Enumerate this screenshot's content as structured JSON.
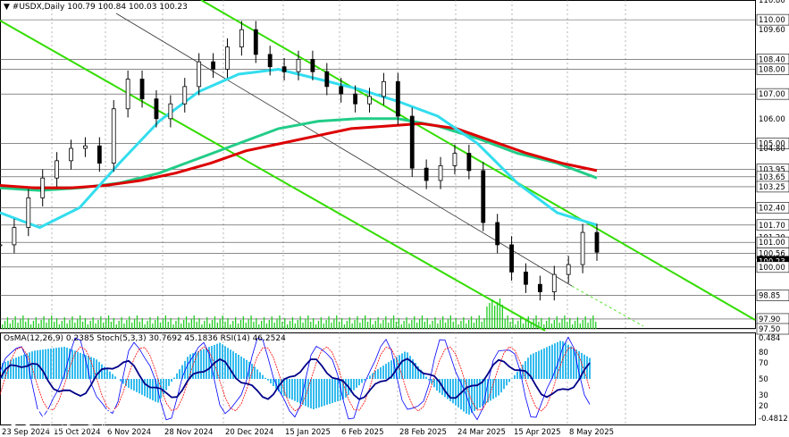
{
  "header": {
    "symbol": "#USDX,Daily",
    "ohlc": "100.79 100.84 100.03 100.23"
  },
  "price_axis": {
    "labels": [
      "110.80",
      "110.00",
      "109.60",
      "108.40",
      "108.00",
      "107.00",
      "106.00",
      "105.00",
      "104.80",
      "103.95",
      "103.65",
      "103.25",
      "102.40",
      "101.70",
      "101.20",
      "101.00",
      "100.56",
      "100.23",
      "100.00",
      "98.85",
      "97.90",
      "97.50"
    ],
    "highlighted": [
      "110.00",
      "108.40",
      "108.00",
      "107.00",
      "105.00",
      "103.95",
      "103.65",
      "103.25",
      "102.40",
      "101.70",
      "101.00",
      "100.56",
      "100.00",
      "98.85",
      "97.90",
      "97.50"
    ],
    "current": "100.23"
  },
  "time_axis": {
    "labels": [
      "23 Sep 2024",
      "15 Oct 2024",
      "6 Nov 2024",
      "28 Nov 2024",
      "20 Dec 2024",
      "15 Jan 2025",
      "6 Feb 2025",
      "28 Feb 2025",
      "24 Mar 2025",
      "15 Apr 2025",
      "8 May 2025"
    ]
  },
  "indicator": {
    "title": "OsMA(12,26,9) 0.2385  Stoch(5,3,3) 30.7692 45.1836  RSI(14) 46.2524",
    "axis_labels": [
      "0.484",
      "80",
      "70",
      "50",
      "30",
      "20",
      "-0.4812"
    ]
  },
  "logo": {
    "name": "instaforex",
    "tagline": "Instant Forex Trading"
  },
  "colors": {
    "price_series": "#000000",
    "ema200": "#dd0000",
    "ema144": "#22cc88",
    "ema50": "#33ddee",
    "channel": "#33dd00",
    "volume": "#22cc22",
    "osma": "#33bbee",
    "stoch_main": "#0000ff",
    "stoch_signal": "#ff0000",
    "rsi": "#000088"
  },
  "chart_data": {
    "type": "line",
    "x_labels": [
      "23 Sep 2024",
      "15 Oct 2024",
      "6 Nov 2024",
      "28 Nov 2024",
      "20 Dec 2024",
      "15 Jan 2025",
      "6 Feb 2025",
      "28 Feb 2025",
      "24 Mar 2025",
      "15 Apr 2025",
      "8 May 2025"
    ],
    "ylim": [
      97.5,
      110.8
    ],
    "series": [
      {
        "name": "price",
        "values": [
          100.9,
          101.6,
          102.8,
          103.6,
          104.3,
          104.8,
          104.9,
          104.2,
          106.4,
          107.6,
          106.8,
          106.0,
          106.6,
          107.3,
          108.3,
          108.0,
          108.9,
          109.6,
          108.6,
          108.1,
          107.9,
          108.4,
          107.9,
          107.3,
          107.0,
          106.6,
          106.9,
          107.5,
          106.1,
          104.0,
          103.5,
          104.1,
          104.6,
          103.9,
          101.8,
          100.9,
          99.8,
          99.3,
          99.0,
          99.7,
          100.1,
          101.4,
          100.6
        ]
      },
      {
        "values": [
          103.3,
          103.2,
          103.2,
          103.3,
          103.5,
          103.8,
          104.2,
          104.7,
          105.0,
          105.3,
          105.6,
          105.7,
          105.8,
          105.6,
          105.1,
          104.6,
          104.2,
          103.9
        ]
      },
      {
        "values": [
          103.2,
          103.1,
          103.2,
          103.4,
          103.8,
          104.4,
          105.0,
          105.6,
          105.9,
          106.0,
          106.0,
          105.7,
          105.2,
          104.6,
          104.2,
          103.6
        ]
      },
      {
        "values": [
          102.2,
          101.6,
          102.4,
          104.2,
          105.9,
          107.1,
          107.8,
          108.0,
          107.6,
          107.2,
          106.7,
          106.1,
          105.0,
          103.4,
          102.2,
          101.7
        ]
      },
      {
        "values": [
          0.2,
          0.35,
          0.4,
          0.25,
          -0.1,
          -0.3,
          0.3,
          0.45,
          0.2,
          -0.2,
          -0.38,
          -0.25,
          0.1,
          0.35,
          -0.15,
          -0.45,
          -0.2,
          0.3,
          0.48,
          0.24
        ]
      }
    ]
  }
}
